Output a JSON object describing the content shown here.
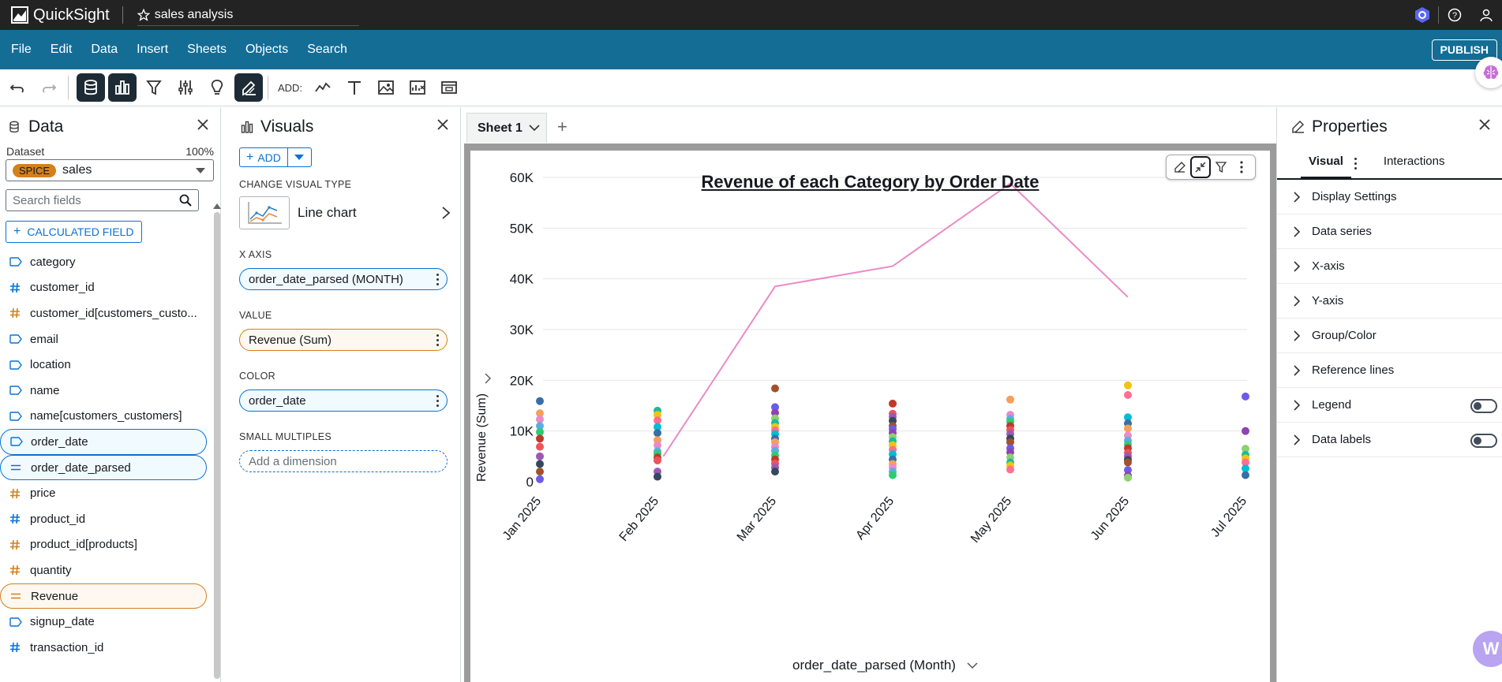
{
  "app": {
    "name": "QuickSight",
    "analysis_title": "sales analysis"
  },
  "menu": [
    "File",
    "Edit",
    "Data",
    "Insert",
    "Sheets",
    "Objects",
    "Search"
  ],
  "publish_label": "PUBLISH",
  "toolbar": {
    "add_label": "ADD:"
  },
  "data_panel": {
    "title": "Data",
    "dataset_label": "Dataset",
    "dataset_pct": "100%",
    "spice_badge": "SPICE",
    "dataset_name": "sales",
    "search_placeholder": "Search fields",
    "calc_field_label": "CALCULATED FIELD",
    "fields": [
      {
        "name": "category",
        "type": "dimension",
        "state": ""
      },
      {
        "name": "customer_id",
        "type": "measure-blue",
        "state": ""
      },
      {
        "name": "customer_id[customers_custo...",
        "type": "measure-orange",
        "state": ""
      },
      {
        "name": "email",
        "type": "dimension",
        "state": ""
      },
      {
        "name": "location",
        "type": "dimension",
        "state": ""
      },
      {
        "name": "name",
        "type": "dimension",
        "state": ""
      },
      {
        "name": "name[customers_customers]",
        "type": "dimension",
        "state": ""
      },
      {
        "name": "order_date",
        "type": "dimension",
        "state": "selected-blue"
      },
      {
        "name": "order_date_parsed",
        "type": "calc",
        "state": "selected-blue"
      },
      {
        "name": "price",
        "type": "measure-orange",
        "state": ""
      },
      {
        "name": "product_id",
        "type": "measure-blue",
        "state": ""
      },
      {
        "name": "product_id[products]",
        "type": "measure-orange",
        "state": ""
      },
      {
        "name": "quantity",
        "type": "measure-orange",
        "state": ""
      },
      {
        "name": "Revenue",
        "type": "calc",
        "state": "selected-orange"
      },
      {
        "name": "signup_date",
        "type": "dimension",
        "state": ""
      },
      {
        "name": "transaction_id",
        "type": "measure-blue",
        "state": ""
      }
    ]
  },
  "visuals_panel": {
    "title": "Visuals",
    "add_label": "ADD",
    "change_type_label": "CHANGE VISUAL TYPE",
    "visual_type": "Line chart",
    "x_axis_label": "X AXIS",
    "x_axis_field": "order_date_parsed (MONTH)",
    "value_label": "VALUE",
    "value_field": "Revenue (Sum)",
    "color_label": "COLOR",
    "color_field": "order_date",
    "small_multiples_label": "SMALL MULTIPLES",
    "small_multiples_placeholder": "Add a dimension"
  },
  "sheet": {
    "tab_label": "Sheet 1"
  },
  "chart_data": {
    "type": "line",
    "title": "Revenue of each Category by Order Date ",
    "xlabel": "order_date_parsed (Month)",
    "ylabel": "Revenue (Sum)",
    "ylim": [
      0,
      60000
    ],
    "yticks": [
      "0",
      "10K",
      "20K",
      "30K",
      "40K",
      "50K",
      "60K"
    ],
    "ytick_values": [
      0,
      10000,
      20000,
      30000,
      40000,
      50000,
      60000
    ],
    "categories": [
      "Jan 2025",
      "Feb 2025",
      "Mar 2025",
      "Apr 2025",
      "May 2025",
      "Jun 2025",
      "Jul 2025"
    ],
    "line": {
      "color": "#e98bc6",
      "x_index": [
        1.05,
        2,
        3,
        4,
        5
      ],
      "values": [
        5000,
        38500,
        42500,
        58800,
        36400
      ]
    },
    "dots": [
      {
        "x": 0,
        "values": [
          15900,
          13500,
          12300,
          11000,
          9800,
          8500,
          6900,
          5000,
          3500,
          2000,
          500
        ]
      },
      {
        "x": 1,
        "values": [
          14000,
          13200,
          12100,
          10800,
          9600,
          8200,
          7200,
          6000,
          5500,
          4800,
          4200,
          2000,
          1000
        ]
      },
      {
        "x": 2,
        "values": [
          18400,
          14700,
          13600,
          12500,
          11600,
          10800,
          10100,
          9400,
          8500,
          7800,
          6900,
          6100,
          5200,
          4400,
          3600,
          2800,
          2000
        ]
      },
      {
        "x": 3,
        "values": [
          15400,
          13400,
          12800,
          12000,
          11000,
          10400,
          9600,
          8800,
          8000,
          7200,
          6300,
          5400,
          4400,
          3500,
          2800,
          2000,
          1300
        ]
      },
      {
        "x": 4,
        "values": [
          16200,
          13200,
          12400,
          11800,
          11000,
          10200,
          9400,
          8500,
          7800,
          6600,
          5800,
          4800,
          3800,
          3200,
          2400
        ]
      },
      {
        "x": 5,
        "values": [
          19000,
          17100,
          12700,
          11500,
          10500,
          9100,
          8100,
          7300,
          6600,
          5700,
          5000,
          4300,
          3800,
          2300,
          1200,
          800
        ]
      },
      {
        "x": 6,
        "values": [
          16800,
          10000,
          6500,
          5300,
          4600,
          3800,
          2600,
          1300
        ]
      }
    ],
    "dot_colors": [
      "#3b6ea5",
      "#e8555d",
      "#8ed16f",
      "#f5a05a",
      "#9b59b6",
      "#1abc9c",
      "#e98bc6",
      "#34495e",
      "#f1c40f",
      "#5dade2",
      "#a0522d",
      "#ff6f91",
      "#2ecc71",
      "#6c5ce7",
      "#00bcd4",
      "#c0392b",
      "#8e44ad"
    ],
    "grid": true,
    "legend": "none"
  },
  "properties_panel": {
    "title": "Properties",
    "tab_visual": "Visual",
    "tab_interactions": "Interactions",
    "rows": [
      {
        "label": "Display Settings",
        "toggle": false
      },
      {
        "label": "Data series",
        "toggle": false
      },
      {
        "label": "X-axis",
        "toggle": false
      },
      {
        "label": "Y-axis",
        "toggle": false
      },
      {
        "label": "Group/Color",
        "toggle": false
      },
      {
        "label": "Reference lines",
        "toggle": false
      },
      {
        "label": "Legend",
        "toggle": true
      },
      {
        "label": "Data labels",
        "toggle": true
      }
    ]
  }
}
